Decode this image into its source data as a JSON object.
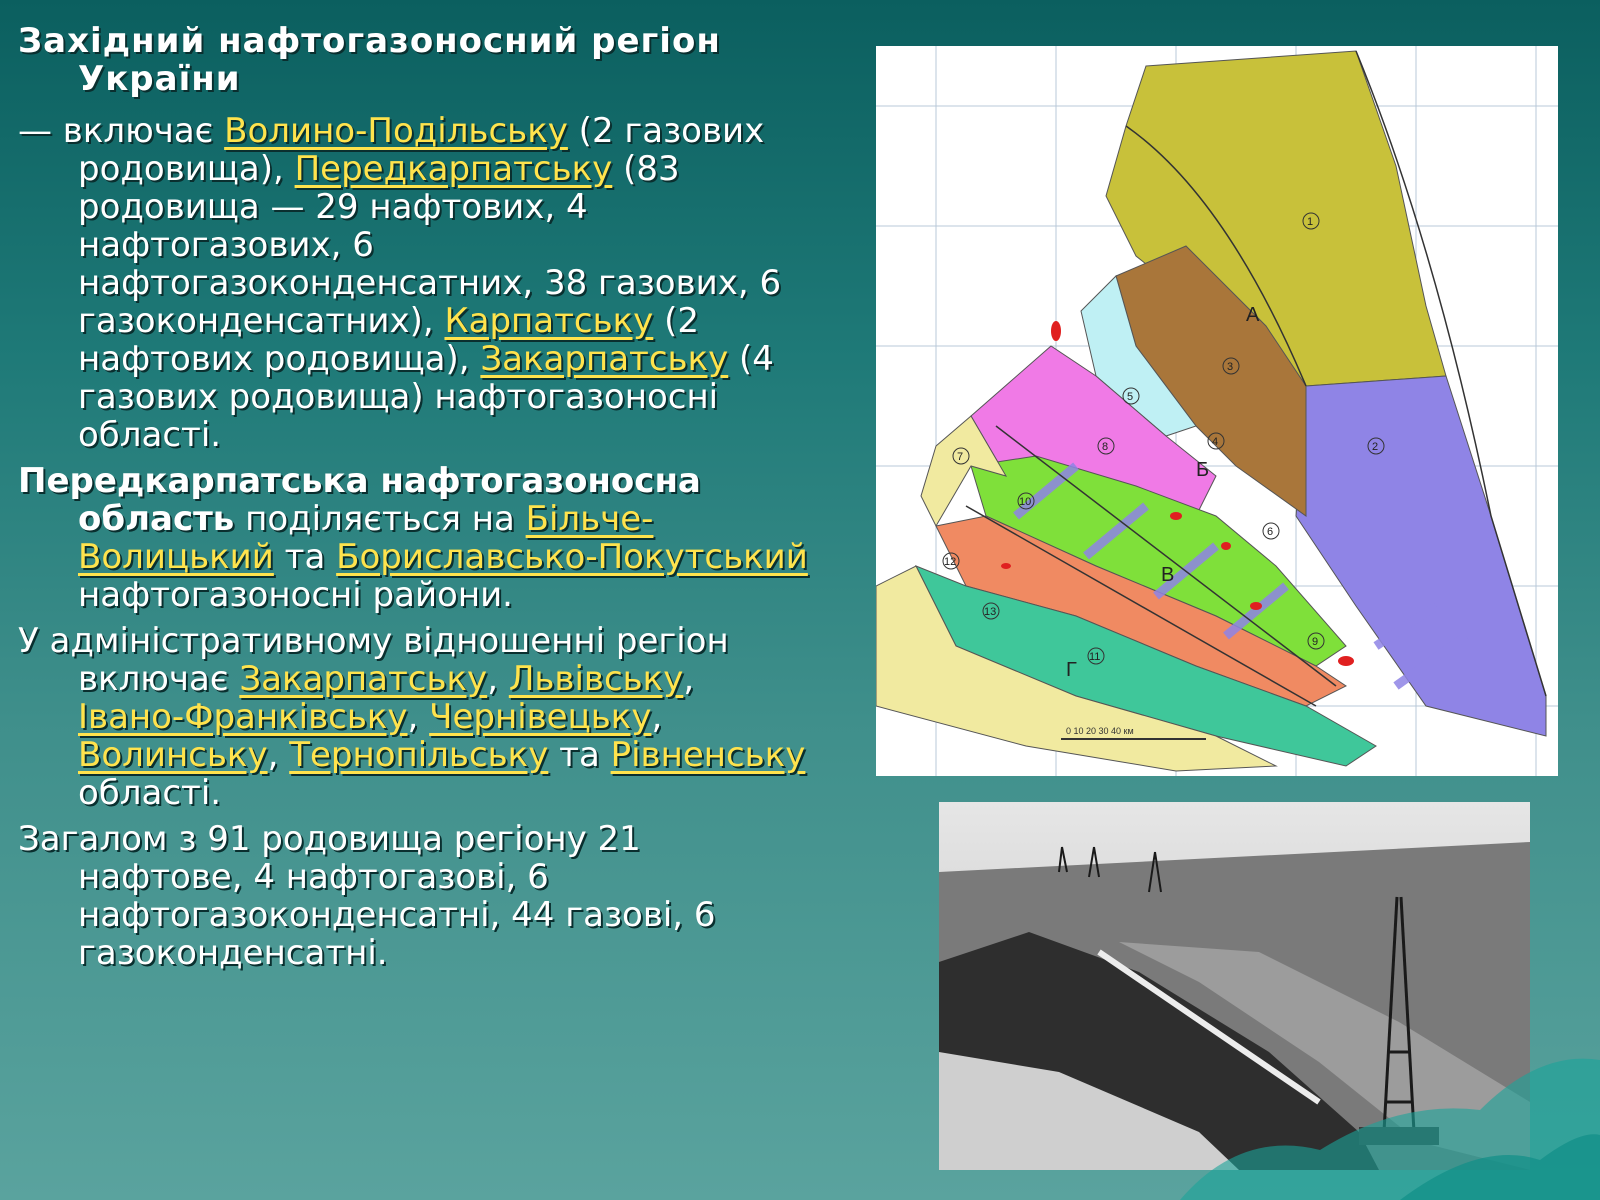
{
  "title": "Західний нафтогазоносний регіон України",
  "para1": {
    "t1": "— включає ",
    "l1": "Волино-Подільську",
    "t2": " (2 газових родовища), ",
    "l2": "Передкарпатську",
    "t3": " (83 родовища — 29 нафтових, 4 нафтогазових, 6 нафтогазоконденсатних, 38 газових, 6 газоконденсатних), ",
    "l3": "Карпатську",
    "t4": " (2 нафтових родовища), ",
    "l4": "Закарпатську",
    "t5": " (4 газових родовища) нафтогазоносні області."
  },
  "para2": {
    "b1": "Передкарпатська нафтогазоносна область",
    "t1": " поділяється на ",
    "l1": "Більче-Волицький",
    "t2": " та ",
    "l2": "Бориславсько-Покутський",
    "t3": " нафтогазоносні райони."
  },
  "para3": {
    "t1": "У адміністративному відношенні регіон включає ",
    "l1": "Закарпатську",
    "s1": ", ",
    "l2": "Львівську",
    "s2": ", ",
    "l3": "Івано-Франківську",
    "s3": ", ",
    "l4": "Чернівецьку",
    "s4": ", ",
    "l5": "Волинську",
    "s5": ", ",
    "l6": "Тернопільську",
    "t2": " та ",
    "l7": "Рівненську",
    "t3": " області."
  },
  "para4": {
    "text": "Загалом з 91 родовища регіону 21 нафтове, 4 нафтогазові, 6 нафтогазоконденсатні, 44 газові, 6 газоконденсатні."
  },
  "map": {
    "zones": [
      "А",
      "Б",
      "В",
      "Г"
    ],
    "nums": [
      "1",
      "2",
      "3",
      "4",
      "5",
      "6",
      "7",
      "8",
      "9",
      "10",
      "11",
      "12",
      "13"
    ],
    "scale": "0  10  20  30  40 км",
    "colors": {
      "yellowgreen": "#c8c13a",
      "brown": "#a9763a",
      "purple": "#8f84e6",
      "cyan": "#bff0f4",
      "pink": "#f07ae6",
      "green": "#7fe03a",
      "salmon": "#f08a62",
      "teal": "#3fc79a",
      "pale": "#f1eaa0"
    }
  },
  "photo": {
    "tones": [
      "#e8e8e8",
      "#6a6a6a",
      "#2a2a2a"
    ]
  }
}
